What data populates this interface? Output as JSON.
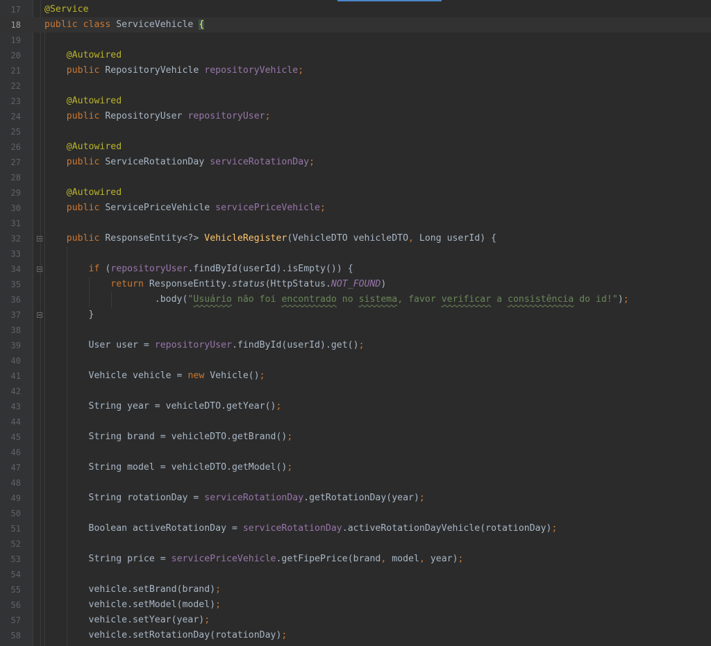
{
  "editor": {
    "lines": [
      {
        "n": "17",
        "t": [
          [
            "ann",
            "@Service"
          ]
        ]
      },
      {
        "n": "18",
        "current": true,
        "t": [
          [
            "kw",
            "public class "
          ],
          [
            "",
            "ServiceVehicle "
          ],
          [
            "brace-hl",
            "{"
          ]
        ]
      },
      {
        "n": "19",
        "t": []
      },
      {
        "n": "20",
        "t": [
          [
            "",
            "    "
          ],
          [
            "ann",
            "@Autowired"
          ]
        ]
      },
      {
        "n": "21",
        "t": [
          [
            "",
            "    "
          ],
          [
            "kw",
            "public "
          ],
          [
            "",
            "RepositoryVehicle "
          ],
          [
            "fld",
            "repositoryVehicle"
          ],
          [
            "kw",
            ";"
          ]
        ]
      },
      {
        "n": "22",
        "t": []
      },
      {
        "n": "23",
        "t": [
          [
            "",
            "    "
          ],
          [
            "ann",
            "@Autowired"
          ]
        ]
      },
      {
        "n": "24",
        "t": [
          [
            "",
            "    "
          ],
          [
            "kw",
            "public "
          ],
          [
            "",
            "RepositoryUser "
          ],
          [
            "fld",
            "repositoryUser"
          ],
          [
            "kw",
            ";"
          ]
        ]
      },
      {
        "n": "25",
        "t": []
      },
      {
        "n": "26",
        "t": [
          [
            "",
            "    "
          ],
          [
            "ann",
            "@Autowired"
          ]
        ]
      },
      {
        "n": "27",
        "t": [
          [
            "",
            "    "
          ],
          [
            "kw",
            "public "
          ],
          [
            "",
            "ServiceRotationDay "
          ],
          [
            "fld",
            "serviceRotationDay"
          ],
          [
            "kw",
            ";"
          ]
        ]
      },
      {
        "n": "28",
        "t": []
      },
      {
        "n": "29",
        "t": [
          [
            "",
            "    "
          ],
          [
            "ann",
            "@Autowired"
          ]
        ]
      },
      {
        "n": "30",
        "t": [
          [
            "",
            "    "
          ],
          [
            "kw",
            "public "
          ],
          [
            "",
            "ServicePriceVehicle "
          ],
          [
            "fld",
            "servicePriceVehicle"
          ],
          [
            "kw",
            ";"
          ]
        ]
      },
      {
        "n": "31",
        "t": []
      },
      {
        "n": "32",
        "fold": true,
        "t": [
          [
            "",
            "    "
          ],
          [
            "kw",
            "public "
          ],
          [
            "",
            "ResponseEntity<?> "
          ],
          [
            "fn",
            "VehicleRegister"
          ],
          [
            "",
            "(VehicleDTO vehicleDTO"
          ],
          [
            "kw",
            ", "
          ],
          [
            "",
            "Long userId) {"
          ]
        ]
      },
      {
        "n": "33",
        "t": []
      },
      {
        "n": "34",
        "fold": true,
        "t": [
          [
            "",
            "        "
          ],
          [
            "kw",
            "if "
          ],
          [
            "",
            "("
          ],
          [
            "fld",
            "repositoryUser"
          ],
          [
            "",
            ".findById(userId).isEmpty()) {"
          ]
        ]
      },
      {
        "n": "35",
        "t": [
          [
            "",
            "            "
          ],
          [
            "kw",
            "return "
          ],
          [
            "",
            "ResponseEntity."
          ],
          [
            "it",
            "status"
          ],
          [
            "",
            "(HttpStatus."
          ],
          [
            "fldit",
            "NOT_FOUND"
          ],
          [
            "",
            ")"
          ]
        ]
      },
      {
        "n": "36",
        "t": [
          [
            "",
            "                    .body("
          ],
          [
            "str",
            "\""
          ],
          [
            "str sq",
            "Usuário"
          ],
          [
            "str",
            " não foi "
          ],
          [
            "str sq",
            "encontrado"
          ],
          [
            "str",
            " no "
          ],
          [
            "str sq",
            "sistema"
          ],
          [
            "str",
            ", favor "
          ],
          [
            "str sq",
            "verificar"
          ],
          [
            "str",
            " a "
          ],
          [
            "str sq",
            "consistência"
          ],
          [
            "str",
            " do id!\""
          ],
          [
            "",
            ")"
          ],
          [
            "kw",
            ";"
          ]
        ]
      },
      {
        "n": "37",
        "fold": true,
        "t": [
          [
            "",
            "        }"
          ]
        ]
      },
      {
        "n": "38",
        "t": []
      },
      {
        "n": "39",
        "t": [
          [
            "",
            "        User user = "
          ],
          [
            "fld",
            "repositoryUser"
          ],
          [
            "",
            ".findById(userId).get()"
          ],
          [
            "kw",
            ";"
          ]
        ]
      },
      {
        "n": "40",
        "t": []
      },
      {
        "n": "41",
        "t": [
          [
            "",
            "        Vehicle vehicle = "
          ],
          [
            "kw",
            "new "
          ],
          [
            "",
            "Vehicle()"
          ],
          [
            "kw",
            ";"
          ]
        ]
      },
      {
        "n": "42",
        "t": []
      },
      {
        "n": "43",
        "t": [
          [
            "",
            "        String year = vehicleDTO.getYear()"
          ],
          [
            "kw",
            ";"
          ]
        ]
      },
      {
        "n": "44",
        "t": []
      },
      {
        "n": "45",
        "t": [
          [
            "",
            "        String brand = vehicleDTO.getBrand()"
          ],
          [
            "kw",
            ";"
          ]
        ]
      },
      {
        "n": "46",
        "t": []
      },
      {
        "n": "47",
        "t": [
          [
            "",
            "        String model = vehicleDTO.getModel()"
          ],
          [
            "kw",
            ";"
          ]
        ]
      },
      {
        "n": "48",
        "t": []
      },
      {
        "n": "49",
        "t": [
          [
            "",
            "        String rotationDay = "
          ],
          [
            "fld",
            "serviceRotationDay"
          ],
          [
            "",
            ".getRotationDay(year)"
          ],
          [
            "kw",
            ";"
          ]
        ]
      },
      {
        "n": "50",
        "t": []
      },
      {
        "n": "51",
        "t": [
          [
            "",
            "        Boolean activeRotationDay = "
          ],
          [
            "fld",
            "serviceRotationDay"
          ],
          [
            "",
            ".activeRotationDayVehicle(rotationDay)"
          ],
          [
            "kw",
            ";"
          ]
        ]
      },
      {
        "n": "52",
        "t": []
      },
      {
        "n": "53",
        "t": [
          [
            "",
            "        String price = "
          ],
          [
            "fld",
            "servicePriceVehicle"
          ],
          [
            "",
            ".getFipePrice(brand"
          ],
          [
            "kw",
            ", "
          ],
          [
            "",
            "model"
          ],
          [
            "kw",
            ", "
          ],
          [
            "",
            "year)"
          ],
          [
            "kw",
            ";"
          ]
        ]
      },
      {
        "n": "54",
        "t": []
      },
      {
        "n": "55",
        "t": [
          [
            "",
            "        vehicle.setBrand(brand)"
          ],
          [
            "kw",
            ";"
          ]
        ]
      },
      {
        "n": "56",
        "t": [
          [
            "",
            "        vehicle.setModel(model)"
          ],
          [
            "kw",
            ";"
          ]
        ]
      },
      {
        "n": "57",
        "t": [
          [
            "",
            "        vehicle.setYear(year)"
          ],
          [
            "kw",
            ";"
          ]
        ]
      },
      {
        "n": "58",
        "t": [
          [
            "",
            "        vehicle.setRotationDay(rotationDay)"
          ],
          [
            "kw",
            ";"
          ]
        ]
      }
    ]
  }
}
